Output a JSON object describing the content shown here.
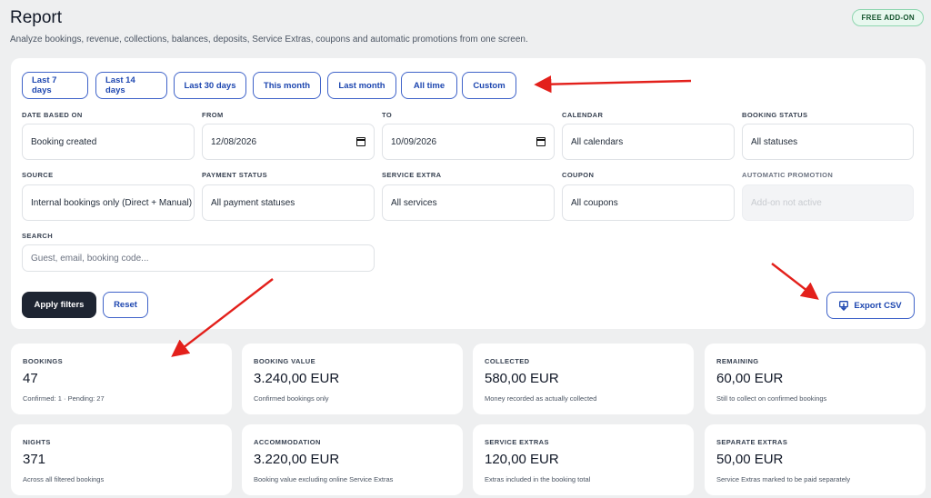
{
  "header": {
    "title": "Report",
    "subtitle": "Analyze bookings, revenue, collections, balances, deposits, Service Extras, coupons and automatic promotions from one screen.",
    "badge": "FREE ADD-ON"
  },
  "quick_ranges": [
    "Last 7 days",
    "Last 14 days",
    "Last 30 days",
    "This month",
    "Last month",
    "All time",
    "Custom"
  ],
  "filters": {
    "date_based_on": {
      "label": "DATE BASED ON",
      "value": "Booking created"
    },
    "from": {
      "label": "FROM",
      "value": "12/08/2026"
    },
    "to": {
      "label": "TO",
      "value": "10/09/2026"
    },
    "calendar": {
      "label": "CALENDAR",
      "value": "All calendars"
    },
    "booking_status": {
      "label": "BOOKING STATUS",
      "value": "All statuses"
    },
    "source": {
      "label": "SOURCE",
      "value": "Internal bookings only (Direct + Manual)"
    },
    "payment_status": {
      "label": "PAYMENT STATUS",
      "value": "All payment statuses"
    },
    "service_extra": {
      "label": "SERVICE EXTRA",
      "value": "All services"
    },
    "coupon": {
      "label": "COUPON",
      "value": "All coupons"
    },
    "automatic_promotion": {
      "label": "AUTOMATIC PROMOTION",
      "value": "Add-on not active"
    },
    "search": {
      "label": "SEARCH",
      "placeholder": "Guest, email, booking code..."
    }
  },
  "actions": {
    "apply": "Apply filters",
    "reset": "Reset",
    "export": "Export CSV"
  },
  "stats": [
    {
      "label": "BOOKINGS",
      "value": "47",
      "sub": "Confirmed: 1 · Pending: 27"
    },
    {
      "label": "BOOKING VALUE",
      "value": "3.240,00 EUR",
      "sub": "Confirmed bookings only"
    },
    {
      "label": "COLLECTED",
      "value": "580,00 EUR",
      "sub": "Money recorded as actually collected"
    },
    {
      "label": "REMAINING",
      "value": "60,00 EUR",
      "sub": "Still to collect on confirmed bookings"
    },
    {
      "label": "NIGHTS",
      "value": "371",
      "sub": "Across all filtered bookings"
    },
    {
      "label": "ACCOMMODATION",
      "value": "3.220,00 EUR",
      "sub": "Booking value excluding online Service Extras"
    },
    {
      "label": "SERVICE EXTRAS",
      "value": "120,00 EUR",
      "sub": "Extras included in the booking total"
    },
    {
      "label": "SEPARATE EXTRAS",
      "value": "50,00 EUR",
      "sub": "Service Extras marked to be paid separately"
    }
  ],
  "colors": {
    "accent": "#3f63c9",
    "annotation_arrow": "#e3201b",
    "badge_bg": "#e8f8ef"
  }
}
